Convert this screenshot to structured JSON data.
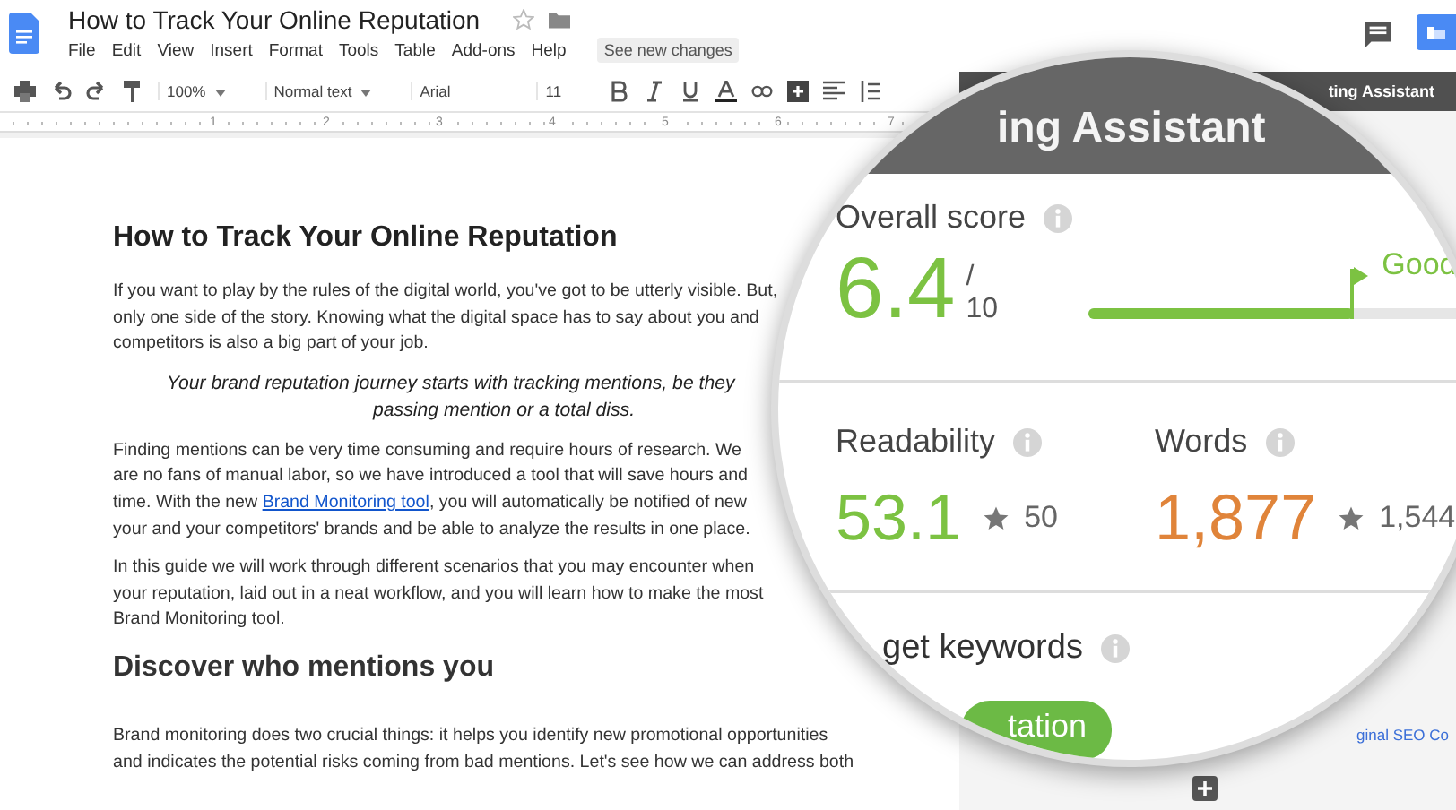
{
  "window": {
    "title": "How to Track Your Online Reputation"
  },
  "menu": [
    "File",
    "Edit",
    "View",
    "Insert",
    "Format",
    "Tools",
    "Table",
    "Add-ons",
    "Help"
  ],
  "changes_button": "See new changes",
  "toolbar": {
    "zoom": "100%",
    "style": "Normal text",
    "font": "Arial",
    "size": "11"
  },
  "ruler": [
    "1",
    "2",
    "3",
    "4",
    "5",
    "6",
    "7"
  ],
  "document": {
    "title": "How to Track Your Online Reputation",
    "blocks": [
      {
        "kind": "para",
        "lines": [
          {
            "text": "If you want to play by the rules of the digital world, you've got to be utterly visible. But,"
          },
          {
            "text": "only one side of the story. Knowing what the digital space has to say about you and"
          },
          {
            "text": "competitors is also a big part of your job."
          }
        ]
      },
      {
        "kind": "quote",
        "lines": [
          {
            "text": "Your brand reputation journey starts with tracking mentions, be they"
          },
          {
            "text": "passing mention or a total diss."
          }
        ]
      },
      {
        "kind": "para",
        "lines": [
          {
            "text": "Finding mentions can be very time consuming and require hours of research. We"
          },
          {
            "text": "are no fans of manual labor, so we have introduced a tool that will save hours and"
          },
          {
            "text": "time. With the new ",
            "link": "Brand Monitoring tool",
            "after": ", you will automatically be notified of new"
          },
          {
            "text": "your and your competitors' brands and be able to analyze the results in one place."
          }
        ]
      },
      {
        "kind": "para",
        "lines": [
          {
            "text": "In this guide we will work through different scenarios that you may encounter when"
          },
          {
            "text": "your reputation, laid out in a neat workflow, and you will learn how to make the most"
          },
          {
            "text": "Brand Monitoring tool."
          }
        ]
      },
      {
        "kind": "heading",
        "lines": [
          {
            "text": "Discover who mentions you"
          }
        ]
      },
      {
        "kind": "para",
        "lines": [
          {
            "text": "Brand monitoring does two crucial things: it helps you identify new promotional opportunities"
          },
          {
            "text": "and indicates the potential risks coming from bad mentions. Let's see how we can address both"
          }
        ]
      }
    ]
  },
  "side_panel": {
    "title": "ting Assistant",
    "link": "ginal SEO Co"
  },
  "magnifier": {
    "title": "ing Assistant",
    "overall": {
      "label": "Overall score",
      "score": "6.4",
      "out_of": "/ 10",
      "level": 0.67,
      "rating": "Good"
    },
    "metrics": [
      {
        "label": "Readability",
        "value": "53.1",
        "target": "50",
        "color": "#7cc242"
      },
      {
        "label": "Words",
        "value": "1,877",
        "target": "1,544",
        "color": "#e0843a"
      }
    ],
    "keywords": {
      "label": "get keywords",
      "tag": "tation"
    }
  }
}
